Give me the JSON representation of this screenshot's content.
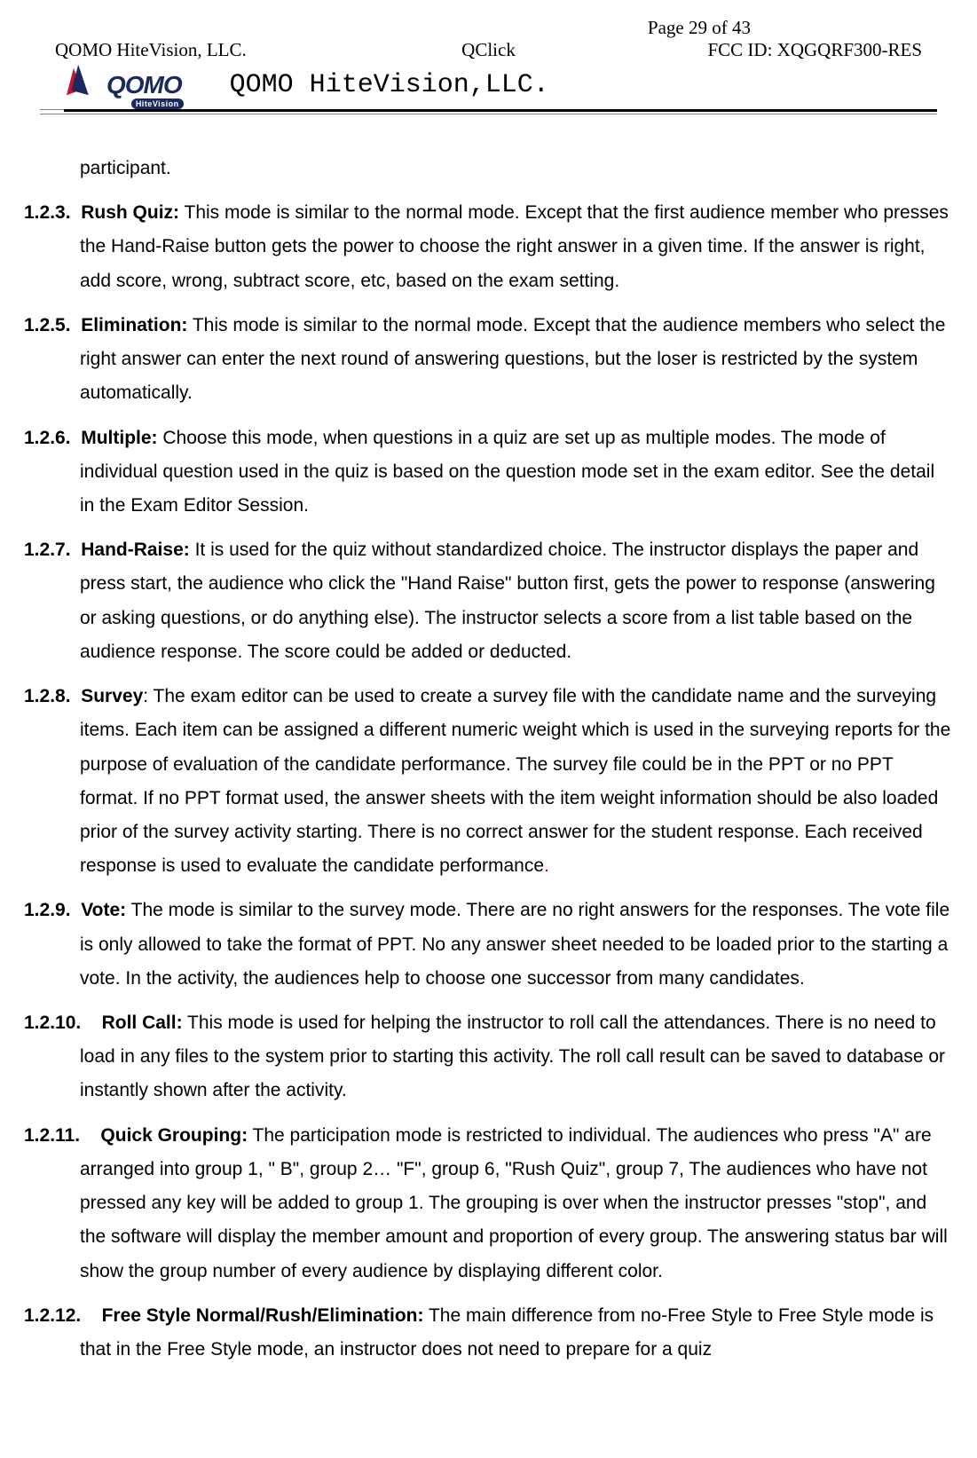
{
  "page_number": "Page 29 of 43",
  "header": {
    "left": "QOMO HiteVision, LLC.",
    "center": "QClick",
    "right": "FCC ID: XQGQRF300-RES"
  },
  "logo": {
    "main_text": "QOMO",
    "sub_text": "HiteVision"
  },
  "company_title": "QOMO HiteVision,LLC.",
  "first_line": "participant.",
  "sections": [
    {
      "num": "1.2.3.",
      "title": "Rush Quiz:",
      "body": " This mode is similar to the normal mode. Except that the first audience member who presses the Hand-Raise button gets the power to choose the right answer in a given time. If the answer is right, add score, wrong, subtract score, etc, based on the exam setting."
    },
    {
      "num": "1.2.5.",
      "title": "Elimination:",
      "body": " This mode is similar to the normal mode. Except that the audience members who select the right answer can enter the next round of answering questions, but the loser is restricted by the system automatically."
    },
    {
      "num": "1.2.6.",
      "title": "Multiple:",
      "body": " Choose this mode, when questions in a quiz are set up as multiple modes. The mode of individual question used in the quiz is based on the question mode set in the exam editor. See the detail in the Exam Editor Session."
    },
    {
      "num": "1.2.7.",
      "title": "Hand-Raise:",
      "body": " It is used for the quiz without standardized choice. The instructor displays the paper and press start, the audience who click the \"Hand Raise\" button first, gets the power to response (answering or asking questions, or do anything else). The instructor selects a score from a list table based on the audience response. The score could be added or deducted."
    },
    {
      "num": "1.2.8.",
      "title": "Survey",
      "body_prefix": ": The exam editor can be used to create a survey file with the candidate name and the surveying items. Each item can be assigned a different numeric weight which is used in the surveying reports for the purpose of evaluation of the candidate performance. The survey file could be in the PPT or no PPT format. If no PPT format used, the answer sheets with the item weight information should be also loaded prior of the survey activity starting. There is no correct answer for the student response. Each received response is used to evaluate the candidate performance",
      "red_period": "."
    },
    {
      "num": "1.2.9.",
      "title": "Vote:",
      "body": " The mode is similar to the survey mode. There are no right answers for the responses. The vote file is only allowed to take the format of PPT. No any answer sheet needed to be loaded prior to the starting a vote. In the activity, the audiences help to choose one successor from many candidates."
    },
    {
      "num": "1.2.10.",
      "title": "Roll Call:",
      "body": " This mode is used for helping the instructor to roll call the attendances. There is no need to load in any files to the system prior to starting this activity. The roll call result can be saved to database or instantly shown after the activity."
    },
    {
      "num": "1.2.11.",
      "title": "Quick Grouping:",
      "body": " The participation mode is restricted to individual. The audiences who press \"A\" are arranged into group 1, \" B\", group 2… \"F\", group 6, \"Rush Quiz\", group 7, The audiences who have not pressed any key will be added to group 1. The grouping is over when the instructor presses \"stop\", and the software will display the member amount and proportion of every group. The answering status bar will show the group number of every audience by displaying different color."
    },
    {
      "num": "1.2.12.",
      "title": "Free Style Normal/Rush/Elimination:",
      "body": " The main difference from no-Free Style to Free Style mode is that in the Free Style mode, an instructor does not need to prepare for a quiz"
    }
  ]
}
